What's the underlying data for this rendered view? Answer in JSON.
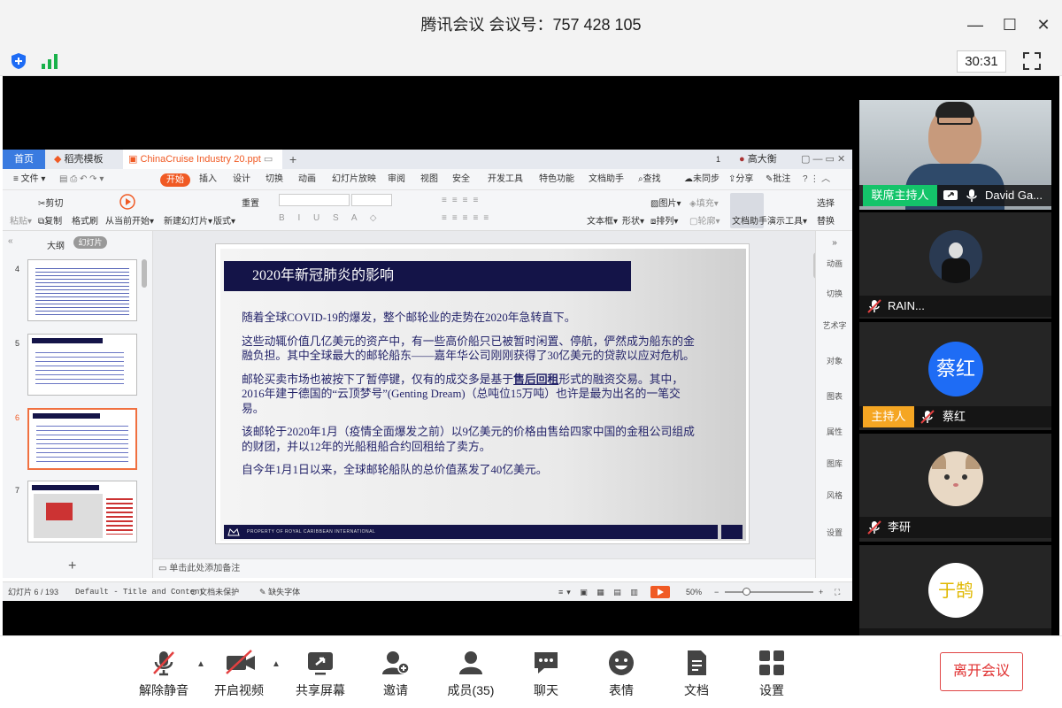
{
  "window": {
    "title": "腾讯会议 会议号：757 428 105",
    "timer": "30:31"
  },
  "wps": {
    "tabs": [
      "首页",
      "稻壳模板",
      "ChinaCruise Industry 20.ppt"
    ],
    "ribbon_tabs": [
      "文件",
      "开始",
      "插入",
      "设计",
      "切换",
      "动画",
      "幻灯片放映",
      "审阅",
      "视图",
      "安全",
      "开发工具",
      "特色功能",
      "文档助手",
      "查找",
      "未同步",
      "分享",
      "批注"
    ],
    "ribbon_buttons": {
      "cut": "剪切",
      "paste": "粘贴",
      "copy": "复制",
      "format_painter": "格式刷",
      "from_start": "从当前开始",
      "new_slide": "新建幻灯片",
      "layout": "版式",
      "reset": "重置",
      "textbox": "文本框",
      "shape": "形状",
      "picture": "图片",
      "fill": "填充",
      "arrange": "排列",
      "outline": "轮廓",
      "doc_assistant": "文档助手",
      "present_tools": "演示工具",
      "replace": "替换",
      "select": "选择"
    },
    "user": "高大衡",
    "sidebar": {
      "tabs": [
        "大纲",
        "幻灯片"
      ],
      "slide_numbers": [
        "4",
        "5",
        "6",
        "7"
      ]
    },
    "slide": {
      "title": "2020年新冠肺炎的影响",
      "para1": "随着全球COVID-19的爆发，整个邮轮业的走势在2020年急转直下。",
      "para2": "这些动辄价值几亿美元的资产中，有一些高价船只已被暂时闲置、停航，俨然成为船东的金融负担。其中全球最大的邮轮船东——嘉年华公司刚刚获得了30亿美元的贷款以应对危机。",
      "para3a": "邮轮买卖市场也被按下了暂停键，仅有的成交多是基于",
      "para3b": "售后回租",
      "para3c": "形式的融资交易。其中，2016年建于德国的“云顶梦号”(Genting Dream)（总吨位15万吨）也许是最为出名的一笔交易。",
      "para4": "该邮轮于2020年1月（疫情全面爆发之前）以9亿美元的价格由售给四家中国的金租公司组成的财团，并以12年的光船租船合约回租给了卖方。",
      "para5": "自今年1月1日以来，全球邮轮船队的总价值蒸发了40亿美元。",
      "footer": "PROPERTY OF ROYAL CARIBBEAN INTERNATIONAL"
    },
    "notes_placeholder": "单击此处添加备注",
    "right_panel": [
      "动画",
      "切换",
      "艺术字",
      "对象",
      "图表",
      "属性",
      "图库",
      "风格",
      "设置"
    ],
    "status": {
      "slide_count": "幻灯片 6 / 193",
      "theme": "Default - Title and Content",
      "protect": "文档未保护",
      "font": "缺失字体",
      "zoom": "50%"
    }
  },
  "participants": [
    {
      "name": "David Ga...",
      "badge": "联席主持人"
    },
    {
      "name": "RAIN..."
    },
    {
      "name": "蔡红",
      "badge": "主持人",
      "avatar_text": "蔡红"
    },
    {
      "name": "李研"
    },
    {
      "avatar_text": "于鹄"
    }
  ],
  "bottom": {
    "mute": "解除静音",
    "video": "开启视频",
    "share": "共享屏幕",
    "invite": "邀请",
    "members": "成员(35)",
    "chat": "聊天",
    "emoji": "表情",
    "docs": "文档",
    "settings": "设置",
    "leave": "离开会议"
  },
  "colors": {
    "leave_red": "#e03030",
    "cohost_green": "#14c46a",
    "host_orange": "#f5a623",
    "avatar_blue": "#1e6cf5",
    "slide_navy": "#141448",
    "wps_orange": "#f05a24"
  }
}
